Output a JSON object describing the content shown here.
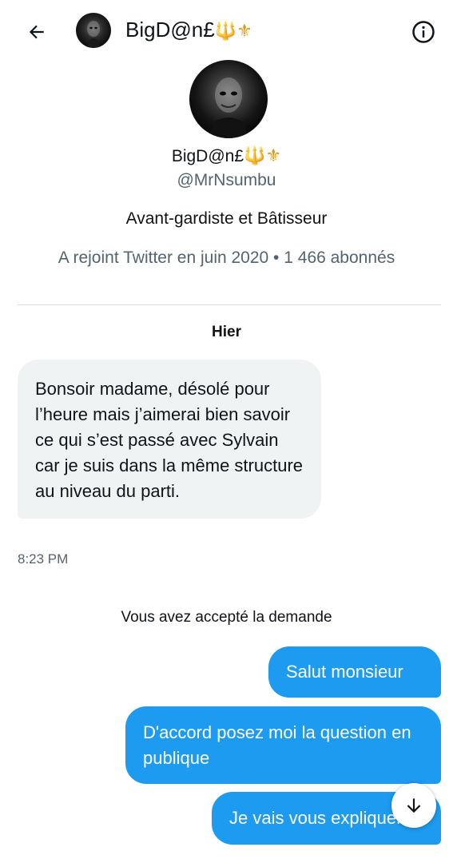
{
  "header": {
    "name": "BigD@n£",
    "name_emoji": "🔱⚜"
  },
  "profile": {
    "name": "BigD@n£",
    "name_emoji": "🔱⚜",
    "handle": "@MrNsumbu",
    "bio": "Avant-gardiste et Bâtisseur",
    "meta": "A rejoint Twitter en juin 2020 • 1 466 abonnés"
  },
  "conversation": {
    "date_separator": "Hier",
    "incoming": [
      {
        "text": "Bonsoir madame, désolé pour l’heure mais j’aimerai bien savoir ce qui s’est passé avec Sylvain car je suis dans la même structure au niveau du parti.",
        "time": "8:23 PM"
      }
    ],
    "system_notice": "Vous avez accepté la demande",
    "outgoing": [
      {
        "text": "Salut monsieur"
      },
      {
        "text": "D'accord posez moi la question en publique"
      },
      {
        "text": "Je vais vous expliquer"
      }
    ]
  },
  "icons": {
    "back": "arrow-left-icon",
    "info": "info-circle-icon",
    "scroll": "arrow-down-icon"
  },
  "colors": {
    "accent": "#1d9bf0",
    "incoming_bubble": "#eff3f4",
    "secondary_text": "#536471"
  }
}
